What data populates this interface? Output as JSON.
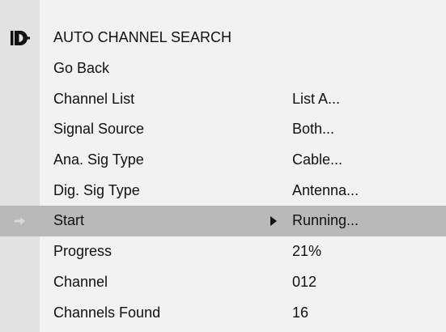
{
  "menu": {
    "title": "AUTO CHANNEL SEARCH",
    "title_icon": "antenna-plug-icon",
    "rows": [
      {
        "label": "Go Back",
        "value": ""
      },
      {
        "label": "Channel List",
        "value": "List A..."
      },
      {
        "label": "Signal Source",
        "value": "Both..."
      },
      {
        "label": "Ana. Sig Type",
        "value": "Cable..."
      },
      {
        "label": "Dig. Sig Type",
        "value": "Antenna..."
      },
      {
        "label": "Start",
        "value": "Running...",
        "selected": true,
        "row_icon": "right-arrow-icon",
        "pointer_icon": "triangle-right-icon"
      },
      {
        "label": "Progress",
        "value": "21%"
      },
      {
        "label": "Channel",
        "value": "012"
      },
      {
        "label": "Channels Found",
        "value": "16"
      }
    ]
  },
  "colors": {
    "background": "#f2f2f2",
    "left_strip": "#e2e2e2",
    "selected_row": "#b9b9b9",
    "text": "#111111"
  }
}
